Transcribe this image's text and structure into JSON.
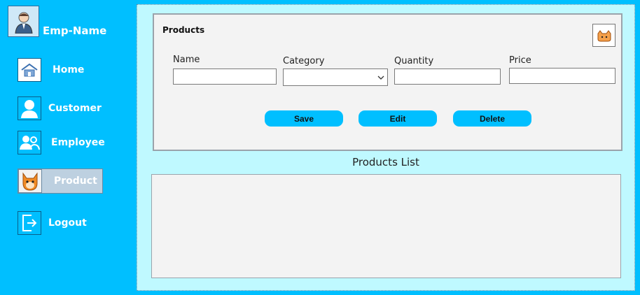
{
  "user": {
    "name": "Emp-Name"
  },
  "nav": {
    "home": "Home",
    "customer": "Customer",
    "employee": "Employee",
    "product": "Product",
    "logout": "Logout"
  },
  "form": {
    "title": "Products",
    "labels": {
      "name": "Name",
      "category": "Category",
      "quantity": "Quantity",
      "price": "Price"
    },
    "values": {
      "name": "",
      "category": "",
      "quantity": "",
      "price": ""
    }
  },
  "buttons": {
    "save": "Save",
    "edit": "Edit",
    "delete": "Delete"
  },
  "list": {
    "title": "Products List"
  },
  "colors": {
    "accent": "#00bfff",
    "panel": "#bff9ff",
    "active_nav": "#bdd0e0"
  }
}
